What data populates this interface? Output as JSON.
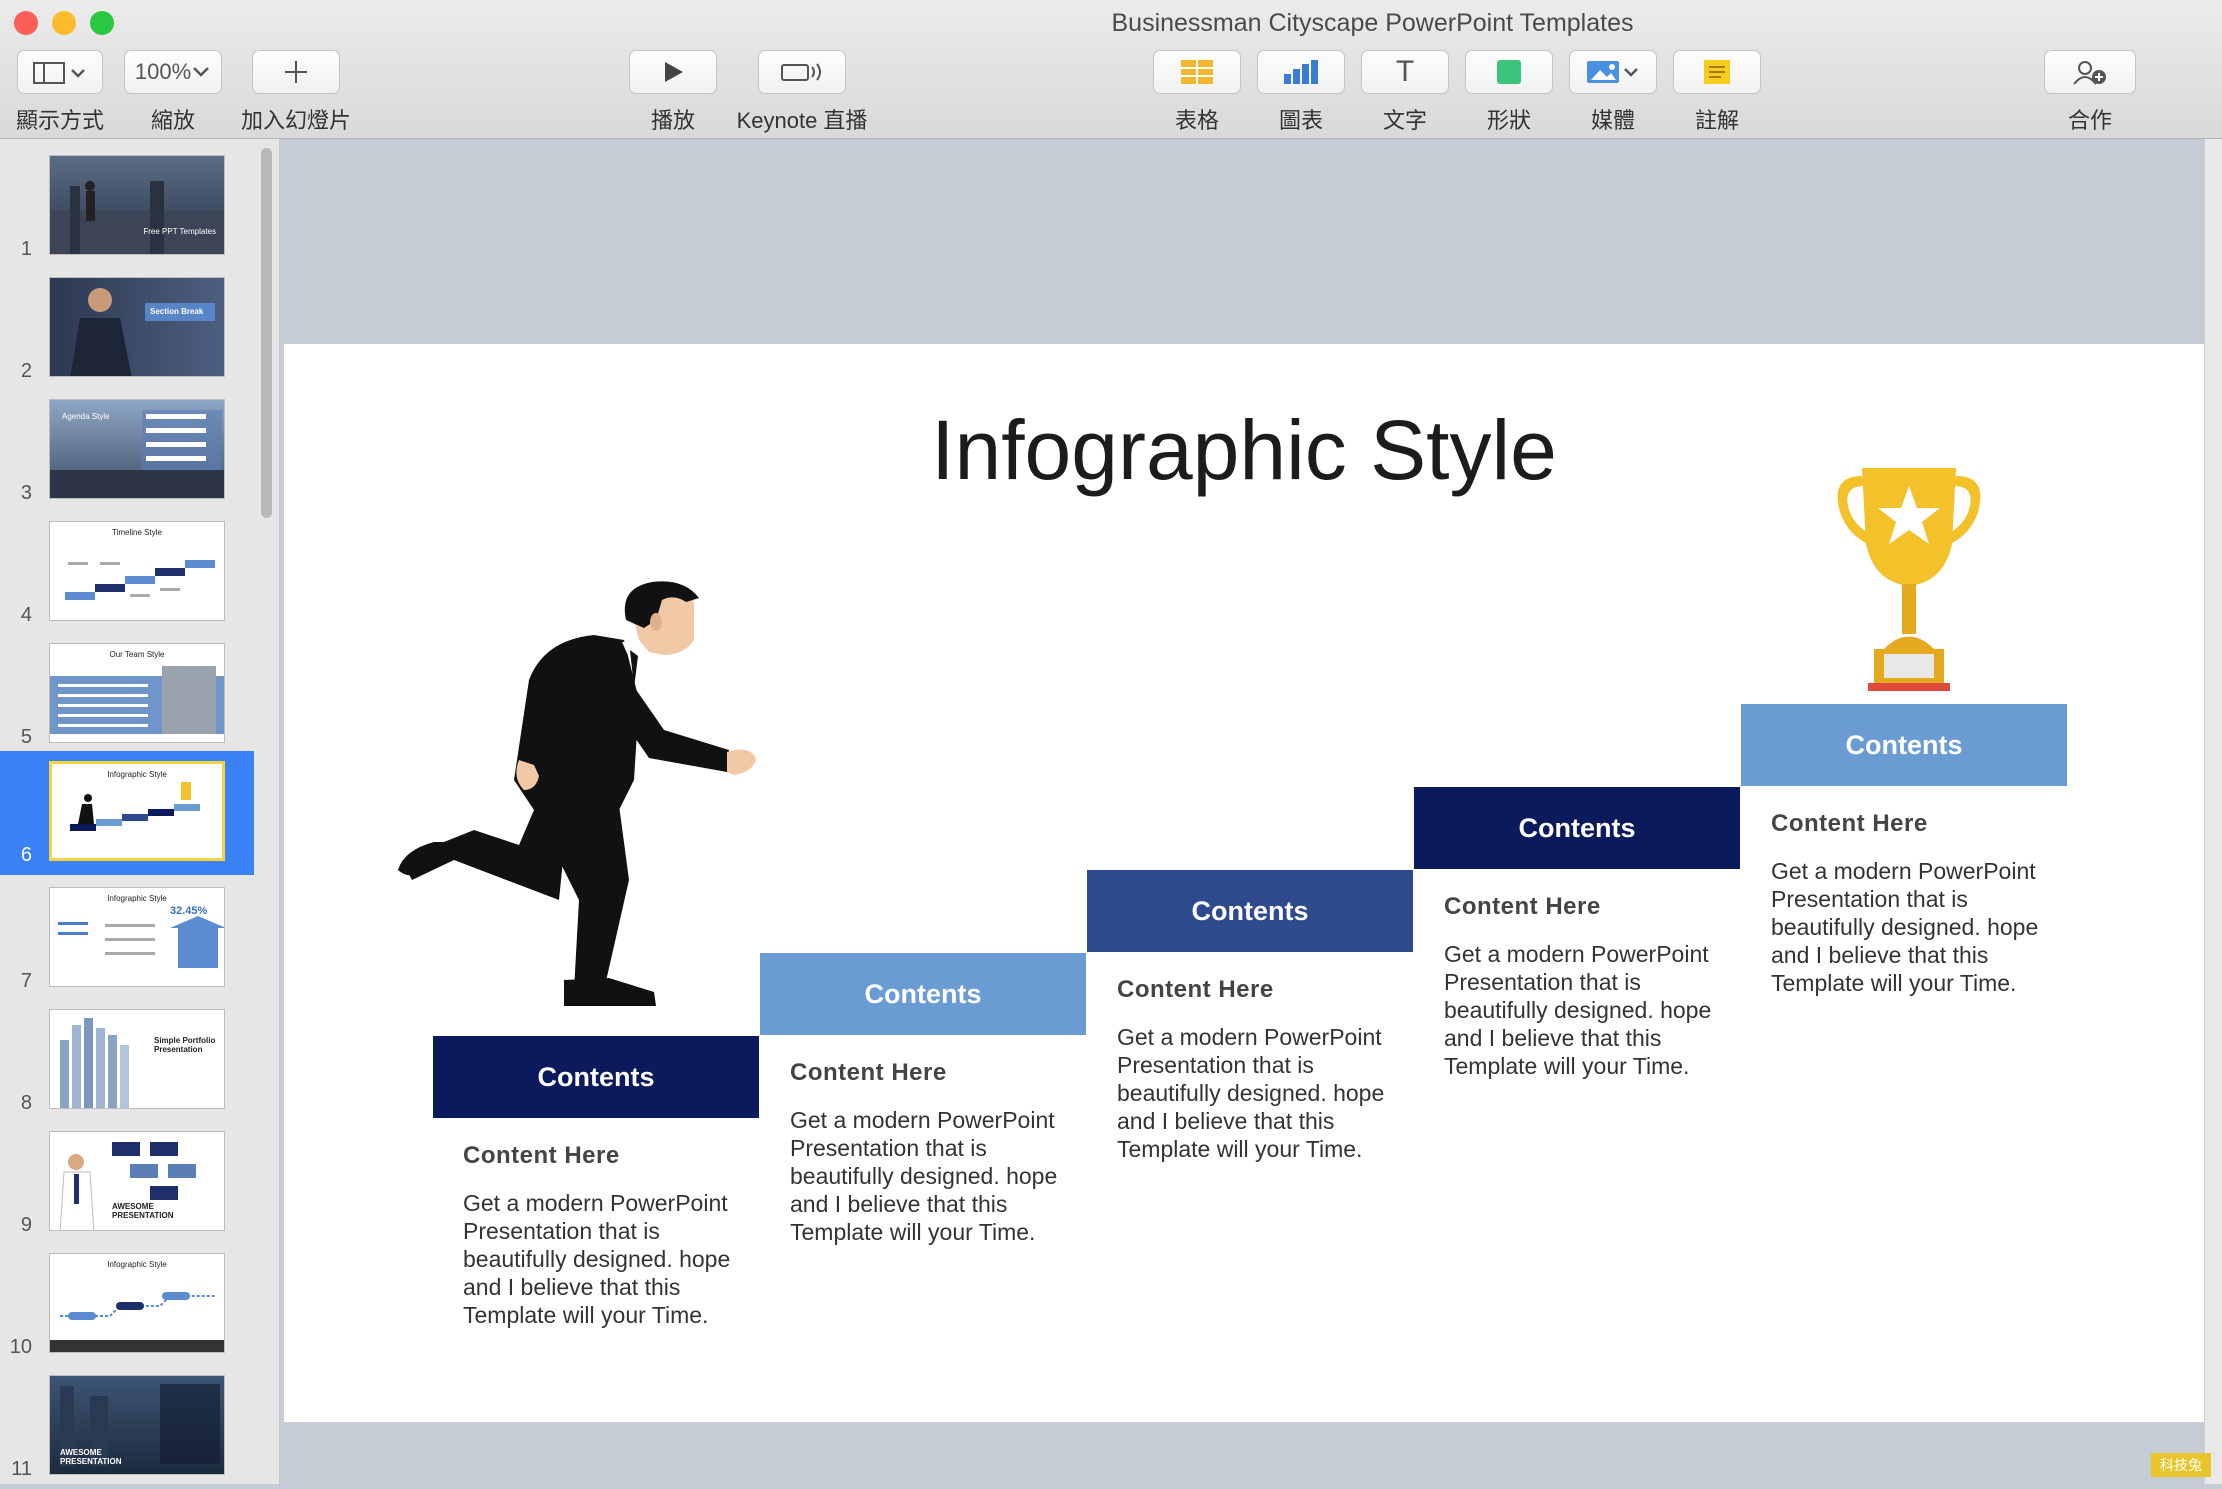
{
  "window": {
    "title": "Businessman Cityscape PowerPoint Templates",
    "traffic_colors": [
      "#fc5f57",
      "#fdbc2e",
      "#28c840"
    ]
  },
  "toolbar": {
    "view": {
      "label": "顯示方式",
      "icon": "sidebar-layout-icon"
    },
    "zoom": {
      "label": "縮放",
      "value": "100%"
    },
    "add_slide": {
      "label": "加入幻燈片",
      "icon": "plus-icon"
    },
    "play": {
      "label": "播放",
      "icon": "play-icon"
    },
    "keynote_live": {
      "label": "Keynote 直播",
      "icon": "broadcast-icon"
    },
    "table": {
      "label": "表格",
      "icon": "table-icon"
    },
    "chart": {
      "label": "圖表",
      "icon": "chart-icon"
    },
    "text": {
      "label": "文字",
      "icon": "T",
      "glyph": "T"
    },
    "shape": {
      "label": "形狀",
      "icon": "shape-icon"
    },
    "media": {
      "label": "媒體",
      "icon": "image-icon"
    },
    "comment": {
      "label": "註解",
      "icon": "comment-icon"
    },
    "collaborate": {
      "label": "合作",
      "icon": "collaborate-icon"
    }
  },
  "sidebar": {
    "slides": [
      {
        "num": "1",
        "kind": "cover",
        "text": "Free PPT Templates"
      },
      {
        "num": "2",
        "kind": "section",
        "text": "Section Break"
      },
      {
        "num": "3",
        "kind": "agenda",
        "text": "Agenda Style"
      },
      {
        "num": "4",
        "kind": "timeline",
        "text": "Timeline Style"
      },
      {
        "num": "5",
        "kind": "team",
        "text": "Our Team Style"
      },
      {
        "num": "6",
        "kind": "infographic-stairs",
        "text": "Infographic Style"
      },
      {
        "num": "7",
        "kind": "infographic-percent",
        "text": "Infographic Style"
      },
      {
        "num": "8",
        "kind": "portfolio",
        "text": "Simple Portfolio Presentation"
      },
      {
        "num": "9",
        "kind": "awesome",
        "text": "AWESOME PRESENTATION"
      },
      {
        "num": "10",
        "kind": "infographic-line",
        "text": "Infographic Style"
      },
      {
        "num": "11",
        "kind": "awesome-dark",
        "text": "AWESOME PRESENTATION"
      }
    ],
    "selected": "6"
  },
  "slide": {
    "title": "Infographic Style",
    "steps": [
      {
        "label": "Contents",
        "color": "#0b1a5c",
        "subtitle": "Content  Here",
        "desc": "Get a modern PowerPoint  Presentation that is beautifully designed. hope and I believe that this Template will your Time."
      },
      {
        "label": "Contents",
        "color": "#6a9bd2",
        "subtitle": "Content  Here",
        "desc": "Get a modern PowerPoint  Presentation that is beautifully designed. hope and I believe that this Template will your Time."
      },
      {
        "label": "Contents",
        "color": "#2e4a8c",
        "subtitle": "Content  Here",
        "desc": "Get a modern PowerPoint Presentation that is beautifully designed. hope and I believe that this Template will your Time."
      },
      {
        "label": "Contents",
        "color": "#0b1a5c",
        "subtitle": "Content  Here",
        "desc": "Get a modern PowerPoint Presentation that is beautifully designed. hope and I believe that this Template will your Time."
      },
      {
        "label": "Contents",
        "color": "#6a9bd2",
        "subtitle": "Content  Here",
        "desc": "Get a modern PowerPoint Presentation that is beautifully designed. hope and I believe that this Template will your Time."
      }
    ]
  },
  "watermark": "科技兔"
}
